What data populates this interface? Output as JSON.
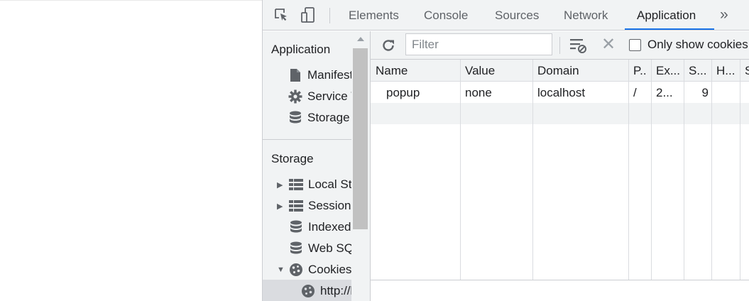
{
  "devtools": {
    "tabs": [
      {
        "label": "Elements"
      },
      {
        "label": "Console"
      },
      {
        "label": "Sources"
      },
      {
        "label": "Network"
      },
      {
        "label": "Application"
      }
    ],
    "more_tabs_label": "»",
    "active_tab": "Application",
    "accent_color": "#1a73e8",
    "icons": {
      "inspect": "inspect-element-icon",
      "device": "device-toolbar-icon",
      "more": "more-tabs-icon"
    }
  },
  "sidebar": {
    "application_section": "Application",
    "application_items": [
      {
        "label": "Manifest",
        "icon": "document-icon"
      },
      {
        "label": "Service Workers",
        "icon": "gear-icon"
      },
      {
        "label": "Storage",
        "icon": "database-icon"
      }
    ],
    "storage_section": "Storage",
    "storage_items": [
      {
        "label": "Local Storage",
        "icon": "grid-icon",
        "expandable": true
      },
      {
        "label": "Session Storage",
        "icon": "grid-icon",
        "expandable": true
      },
      {
        "label": "IndexedDB",
        "icon": "database-icon"
      },
      {
        "label": "Web SQL",
        "icon": "database-icon"
      },
      {
        "label": "Cookies",
        "icon": "cookie-icon",
        "expanded": true
      }
    ],
    "cookies_child": {
      "label": "http://localhost",
      "icon": "cookie-icon",
      "selected": true
    }
  },
  "toolbar": {
    "filter_placeholder": "Filter",
    "filter_value": "",
    "only_show_label": "Only show cookies with an issue",
    "only_show_checked": false
  },
  "table": {
    "headers": [
      "Name",
      "Value",
      "Domain",
      "P..",
      "Ex...",
      "S...",
      "H...",
      "S"
    ],
    "rows": [
      {
        "name": "popup",
        "value": "none",
        "domain": "localhost",
        "path": "/",
        "expires": "2...",
        "size": "9",
        "httponly": ""
      }
    ]
  }
}
